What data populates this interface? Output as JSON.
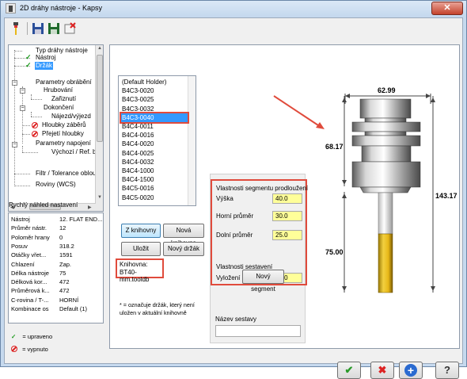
{
  "window": {
    "title": "2D dráhy nástroje - Kapsy",
    "close_label": "✕"
  },
  "toolbar": {
    "icons": [
      "tool-icon",
      "save-icon",
      "save-all-icon",
      "clear-icon"
    ]
  },
  "tree": {
    "items": [
      {
        "label": "Typ dráhy nástroje",
        "state": "none"
      },
      {
        "label": "Nástroj",
        "state": "check"
      },
      {
        "label": "Držák",
        "state": "check",
        "selected": true
      },
      {
        "label": "Parametry obrábění",
        "state": "none"
      },
      {
        "label": "Hrubování",
        "state": "none"
      },
      {
        "label": "Zařiznutí",
        "state": "none"
      },
      {
        "label": "Dokončení",
        "state": "none"
      },
      {
        "label": "Nájezd/výjezd",
        "state": "none"
      },
      {
        "label": "Hloubky záběrů",
        "state": "off"
      },
      {
        "label": "Přejetí hloubky",
        "state": "off"
      },
      {
        "label": "Parametry napojení",
        "state": "none"
      },
      {
        "label": "Výchozí / Ref. bod",
        "state": "none"
      },
      {
        "label": "Filtr / Tolerance oblouků",
        "state": "none"
      },
      {
        "label": "Roviny (WCS)",
        "state": "none"
      }
    ]
  },
  "quick_preview": {
    "title": "Rychlý náhled nastavení",
    "rows": [
      {
        "k": "Nástroj",
        "v": "12. FLAT END..."
      },
      {
        "k": "Průměr nástr.",
        "v": "12"
      },
      {
        "k": "Poloměr hrany",
        "v": "0"
      },
      {
        "k": "Posuv",
        "v": "318.2"
      },
      {
        "k": "Otáčky vřet...",
        "v": "1591"
      },
      {
        "k": "Chlazení",
        "v": "Zap."
      },
      {
        "k": "Délka nástroje",
        "v": "75"
      },
      {
        "k": "Délková kor...",
        "v": "472"
      },
      {
        "k": "Průměrová k...",
        "v": "472"
      },
      {
        "k": "C-rovina / T-...",
        "v": "HORNÍ"
      },
      {
        "k": "Kombinace os",
        "v": "Default (1)"
      }
    ]
  },
  "legend": {
    "edited": "= upraveno",
    "disabled": "= vypnuto"
  },
  "holders": {
    "items": [
      "(Default Holder)",
      "B4C3-0020",
      "B4C3-0025",
      "B4C3-0032",
      "B4C3-0040",
      "B4C4-0011",
      "B4C4-0016",
      "B4C4-0020",
      "B4C4-0025",
      "B4C4-0032",
      "B4C4-1000",
      "B4C4-1500",
      "B4C5-0016",
      "B4C5-0020"
    ],
    "selected_index": 4
  },
  "buttons": {
    "from_library": "Z knihovny",
    "new_library": "Nová knihovna",
    "save": "Uložit",
    "new_holder": "Nový držák",
    "new_segment": "Nový segment"
  },
  "library": {
    "label": "Knihovna:",
    "value": "BT40-mm.tooldb"
  },
  "note": "* = označuje držák, který není uložen v aktuální knihovně",
  "segment": {
    "section_title": "Vlastnosti segmentu prodloužení",
    "height_label": "Výška",
    "height": "40.0",
    "top_diam_label": "Horní průměr",
    "top_diam": "30.0",
    "bottom_diam_label": "Dolní průměr",
    "bottom_diam": "25.0",
    "assembly_title": "Vlastnosti sestavení",
    "overhang_label": "Vyložení nástroje",
    "overhang": "75.0",
    "assembly_name_label": "Název sestavy",
    "assembly_name": ""
  },
  "drawing": {
    "dim_top": "62.99",
    "dim_left": "68.17",
    "dim_right": "143.17",
    "dim_tool": "75.00"
  },
  "colors": {
    "highlight": "#e04b3c",
    "field_bg": "#ffff99",
    "selection": "#3399ff",
    "tool_gold": "#e8b818"
  },
  "dialog": {
    "ok_icon": "✔",
    "cancel_icon": "✖",
    "add_icon": "+",
    "help_icon": "?"
  }
}
